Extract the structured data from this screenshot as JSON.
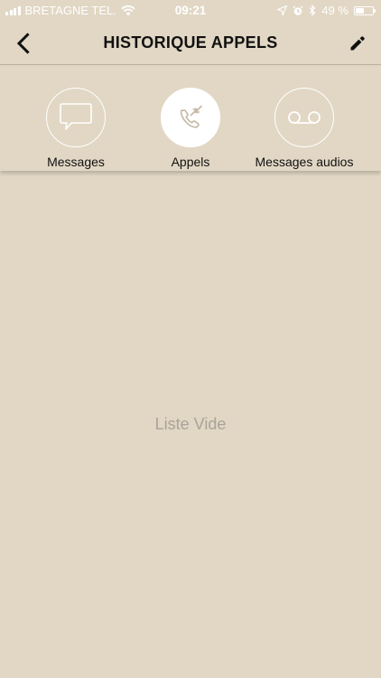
{
  "status_bar": {
    "carrier": "BRETAGNE TEL.",
    "time": "09:21",
    "battery_text": "49 %",
    "battery_level": 0.49,
    "icons": [
      "signal-icon",
      "wifi-icon",
      "location-arrow-icon",
      "alarm-icon",
      "bluetooth-icon",
      "battery-icon"
    ]
  },
  "nav": {
    "title": "HISTORIQUE APPELS",
    "back_icon": "chevron-left-icon",
    "edit_icon": "pencil-icon"
  },
  "tabs": [
    {
      "label": "Messages",
      "icon": "chat-bubble-icon",
      "active": false
    },
    {
      "label": "Appels",
      "icon": "phone-calls-icon",
      "active": true
    },
    {
      "label": "Messages audios",
      "icon": "voicemail-icon",
      "active": false
    }
  ],
  "empty_list": {
    "text": "Liste Vide"
  },
  "colors": {
    "background": "#e1d7c4",
    "accent": "#ffffff",
    "muted_text": "#aaa39a"
  }
}
